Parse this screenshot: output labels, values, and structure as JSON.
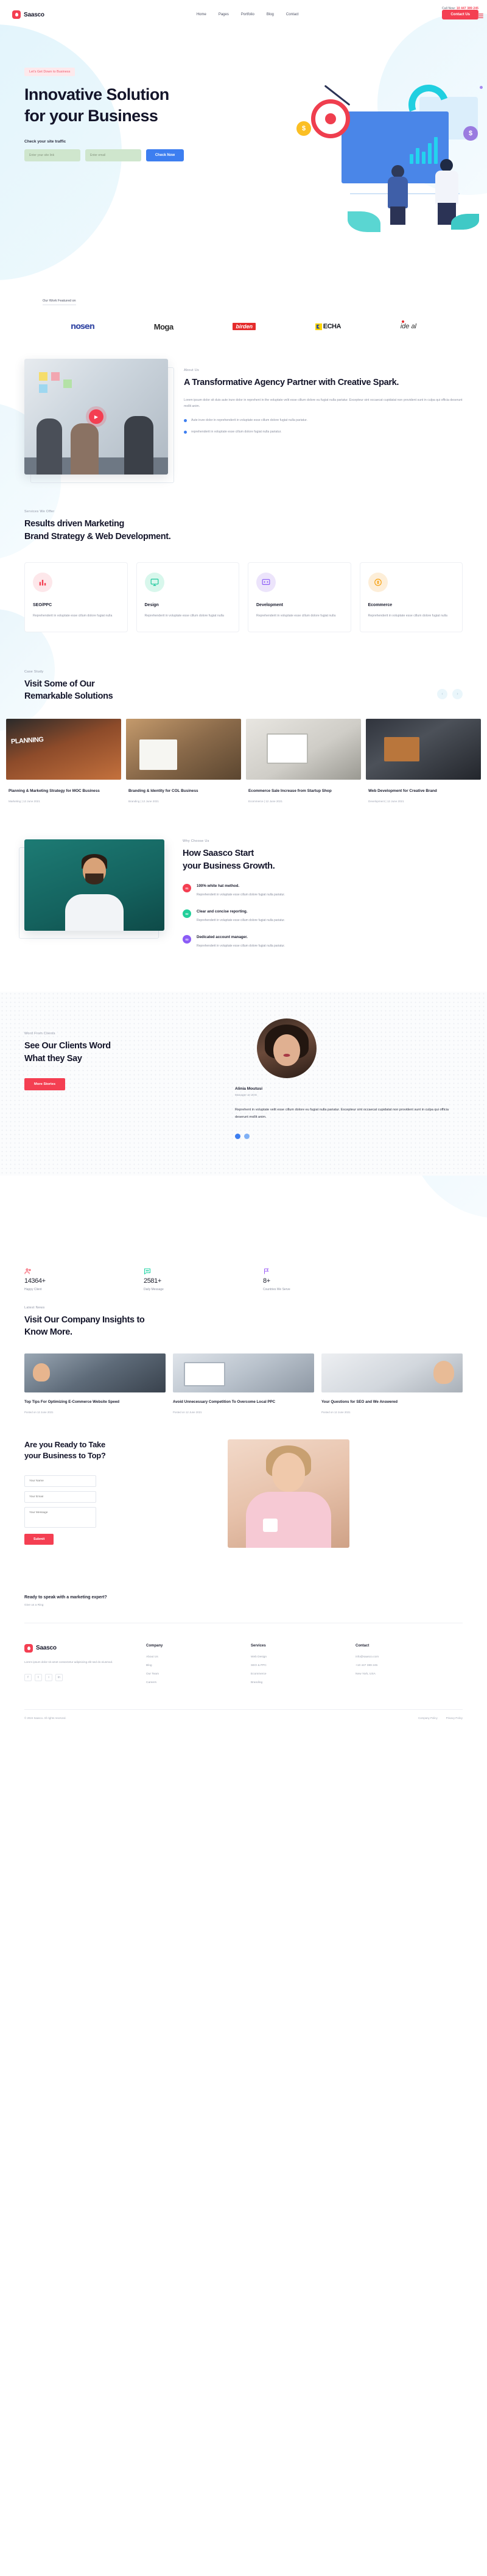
{
  "brand": {
    "name": "Saasco",
    "logo_icon": "droplet-icon"
  },
  "topbar": {
    "call_label": "Call Now:",
    "phone": "10 447 389 245"
  },
  "nav": {
    "items": [
      {
        "label": "Home"
      },
      {
        "label": "Pages"
      },
      {
        "label": "Portfolio"
      },
      {
        "label": "Blog"
      },
      {
        "label": "Contact"
      }
    ],
    "cta": "Contact Us",
    "menu_icon": "hamburger-icon"
  },
  "hero": {
    "chip": "Let's Get Down to Business",
    "title_line1": "Innovative Solution",
    "title_line2": "for your Business",
    "sub": "Check your site traffic",
    "input_site_placeholder": "Enter your site link",
    "input_email_placeholder": "Enter email",
    "button": "Check Now"
  },
  "featured": {
    "label": "Our Work Featured on",
    "logos": [
      {
        "name": "nosen",
        "text": "nosen"
      },
      {
        "name": "moga",
        "text": "Moga"
      },
      {
        "name": "birden",
        "text": "birden"
      },
      {
        "name": "echa",
        "text": "ECHA"
      },
      {
        "name": "ideal",
        "text": "ide al"
      }
    ]
  },
  "about": {
    "eyebrow": "About Us",
    "title": "A Transformative Agency Partner with Creative Spark.",
    "body": "Lorem ipsum dolor sit duis aute irure dolor in reprehent in the voluptate velit esse cillum dolore eu fugiat nulla pariatur. Excepteur sint occaecat cupidatat non provident sunt in culpa qui officia deserunt mollit anim.",
    "bullets": [
      "Aute irure dolor in reprehenderit in voluptate esse cillum dolore fugiat nulla pariatur.",
      "reprehenderit in voluptate esse cillum dolore fugiat nulla pariatur."
    ],
    "play_icon": "play-icon"
  },
  "services": {
    "eyebrow": "Services We Offer",
    "title_line1": "Results driven Marketing",
    "title_line2": "Brand Strategy & Web Development.",
    "cards": [
      {
        "icon": "bar-chart-icon",
        "title": "SEO/PPC",
        "text": "Reprehenderit in voluptate esse cillum dolore fugiat nulla"
      },
      {
        "icon": "monitor-icon",
        "title": "Design",
        "text": "Reprehenderit in voluptate esse cillum dolore fugiat nulla"
      },
      {
        "icon": "code-icon",
        "title": "Development",
        "text": "Reprehenderit in voluptate esse cillum dolore fugiat nulla"
      },
      {
        "icon": "shopping-icon",
        "title": "Ecommerce",
        "text": "Reprehenderit in voluptate esse cillum dolore fugiat nulla"
      }
    ]
  },
  "cases": {
    "eyebrow": "Case Study",
    "title_line1": "Visit Some of Our",
    "title_line2": "Remarkable Solutions",
    "prev_icon": "chevron-left-icon",
    "next_icon": "chevron-right-icon",
    "items": [
      {
        "title": "Planning & Marketing Strategy for MOC Business",
        "meta": "Marketing | 12 June 2021"
      },
      {
        "title": "Branding & Identity for COL Business",
        "meta": "Branding | 12 June 2021"
      },
      {
        "title": "Ecommerce Sale Increase from Startup Shop",
        "meta": "Ecommerce | 12 June 2021"
      },
      {
        "title": "Web Development for Creative Brand",
        "meta": "Development | 12 June 2021"
      }
    ]
  },
  "why": {
    "eyebrow": "Why Choose Us",
    "title_line1": "How Saasco Start",
    "title_line2": "your Business Growth.",
    "steps": [
      {
        "num": "01",
        "title": "100% white hat method.",
        "text": "Reprehenderit in voluptate esse cillum dolore fugiat nulla pariatur."
      },
      {
        "num": "02",
        "title": "Clear and concise reporting.",
        "text": "Reprehenderit in voluptate esse cillum dolore fugiat nulla pariatur."
      },
      {
        "num": "03",
        "title": "Dedicated account manager.",
        "text": "Reprehenderit in voluptate esse cillum dolore fugiat nulla pariatur."
      }
    ]
  },
  "testimonial": {
    "eyebrow": "Word From Clients",
    "title_line1": "See Our Clients Word",
    "title_line2": "What they Say",
    "button": "More Stories",
    "name": "Alinia Moutusi",
    "role": "Manager at UOS",
    "quote": "Reprehent in voluptate velit esse cillum dolore eu fugiat nulla pariatur. Excepteur sint occaecat cupidatat non provident sunt in culpa qui officia deserunt mollit anim."
  },
  "stats": [
    {
      "icon": "users-icon",
      "value": "14364+",
      "label": "Happy Client"
    },
    {
      "icon": "message-icon",
      "value": "2581+",
      "label": "Daily Message"
    },
    {
      "icon": "flag-icon",
      "value": "8+",
      "label": "Countries We Serve"
    }
  ],
  "blog": {
    "eyebrow": "Latest News",
    "title_line1": "Visit Our Company Insights to",
    "title_line2": "Know More.",
    "posts": [
      {
        "title": "Top Tips For Optimizing E-Commerce Website Speed",
        "meta": "Posted on 12 June 2021"
      },
      {
        "title": "Avoid Unnecessary Competition To Overcome Local PPC",
        "meta": "Posted on 12 June 2021"
      },
      {
        "title": "Your Questions for SEO and We Answered",
        "meta": "Posted on 12 June 2021"
      }
    ]
  },
  "cta": {
    "title_line1": "Are you Ready to Take",
    "title_line2": "your Business to Top?",
    "name_placeholder": "Your Name",
    "email_placeholder": "Your Email",
    "message_placeholder": "Your Message",
    "button": "Submit"
  },
  "ready": {
    "title": "Ready to speak with a marketing expert?",
    "sub": "Give us a Ring"
  },
  "footer": {
    "desc": "Lorem ipsum dolor sit amet consectetur adipisicing elit sed do eiusmod.",
    "social": [
      {
        "name": "facebook-icon",
        "glyph": "f"
      },
      {
        "name": "twitter-icon",
        "glyph": "t"
      },
      {
        "name": "instagram-icon",
        "glyph": "i"
      },
      {
        "name": "linkedin-icon",
        "glyph": "in"
      }
    ],
    "columns": [
      {
        "heading": "Company",
        "links": [
          "About Us",
          "Blog",
          "Our Team",
          "Careers"
        ]
      },
      {
        "heading": "Services",
        "links": [
          "Web Design",
          "SEO & PPC",
          "Ecommerce",
          "Branding"
        ]
      },
      {
        "heading": "Contact",
        "links": [
          "info@saasco.com",
          "+10 447 389 245",
          "New York, USA"
        ]
      }
    ],
    "copyright": "© 2024 Saasco. All rights reserved.",
    "legal": [
      "Company Policy",
      "Privacy Policy"
    ]
  }
}
